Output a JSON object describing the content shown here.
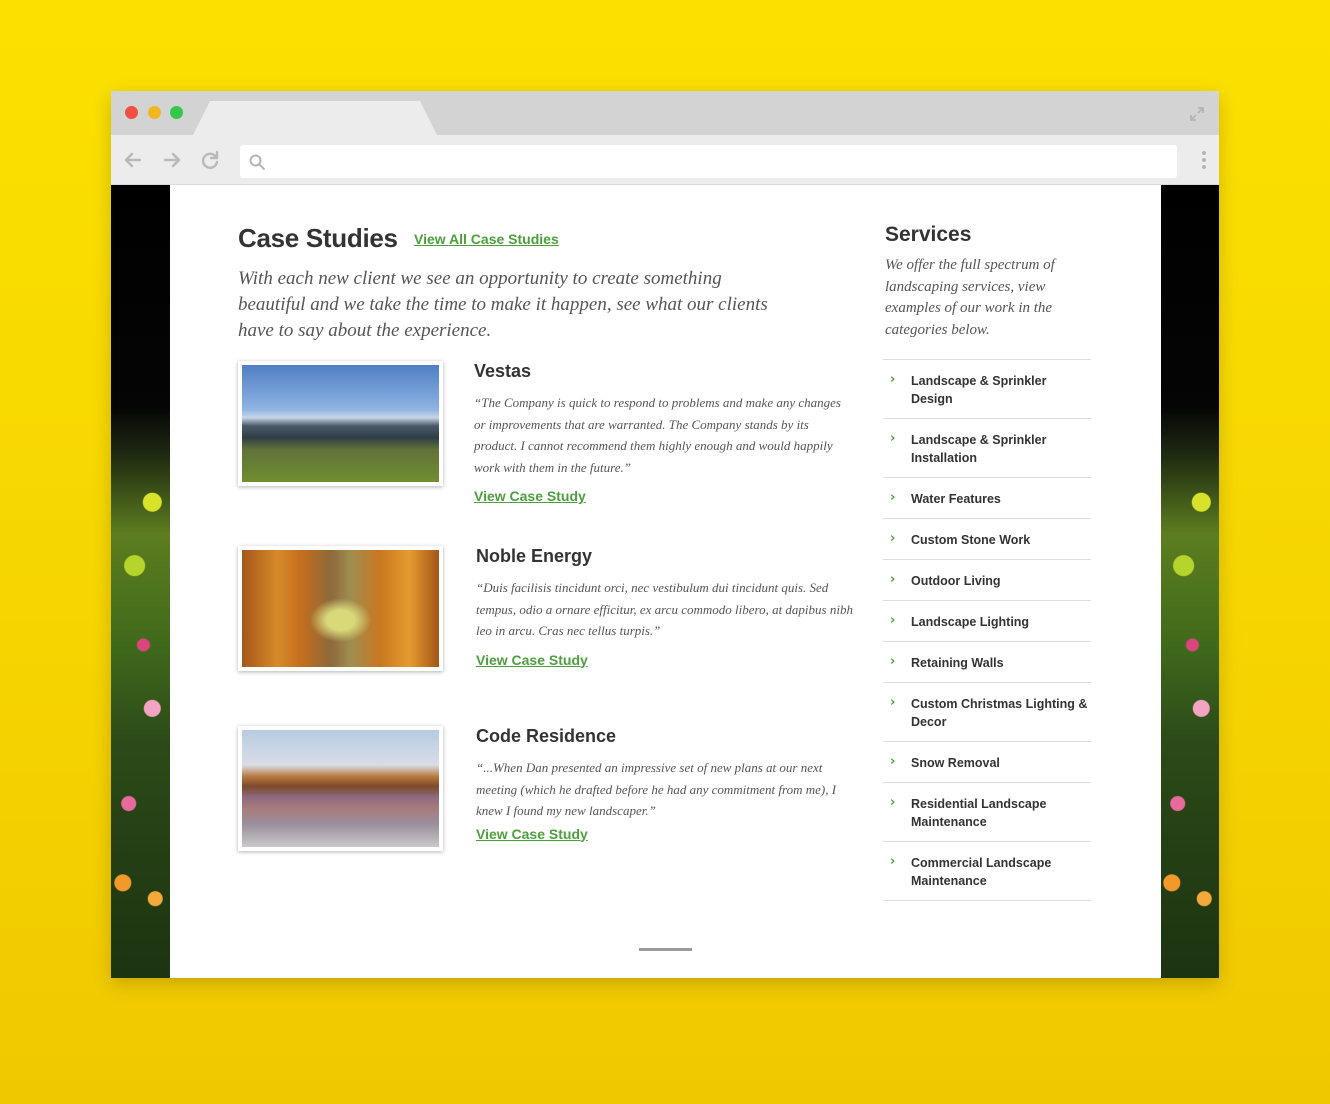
{
  "browser": {
    "url": "",
    "icons": {
      "back": "arrow-left-icon",
      "forward": "arrow-right-icon",
      "reload": "reload-icon",
      "search": "search-icon",
      "menu": "kebab-menu-icon",
      "expand": "expand-icon"
    }
  },
  "case_studies": {
    "title": "Case Studies",
    "view_all_label": "View All Case Studies",
    "intro": "With each new client we see an opportunity to create something beautiful and we take the time to make it happen, see what our clients have to say about the experience.",
    "items": [
      {
        "title": "Vestas",
        "quote": "“The Company is quick to respond to problems and make any changes or improvements that are warranted. The Company stands by its product. I cannot recommend them highly enough and would happily work with them in the future.”",
        "link_label": "View Case Study"
      },
      {
        "title": "Noble Energy",
        "quote": "“Duis facilisis tincidunt orci, nec vestibulum dui tincidunt quis. Sed tempus, odio a ornare efficitur, ex arcu commodo libero, at dapibus nibh leo in arcu. Cras nec tellus turpis.”",
        "link_label": "View Case Study"
      },
      {
        "title": "Code Residence",
        "quote": "“...When Dan presented an impressive set of new plans at our next meeting (which he drafted before he had any commitment from me), I knew I found my new landscaper.”",
        "link_label": "View Case Study"
      }
    ]
  },
  "services": {
    "title": "Services",
    "description": "We offer the full spectrum of landscaping services, view examples of our work in the categories below.",
    "items": [
      "Landscape & Sprinkler Design",
      "Landscape & Sprinkler Installation",
      "Water Features",
      "Custom Stone Work",
      "Outdoor Living",
      "Landscape Lighting",
      "Retaining Walls",
      "Custom Christmas Lighting & Decor",
      "Snow Removal",
      "Residential Landscape Maintenance",
      "Commercial Landscape Maintenance"
    ]
  },
  "colors": {
    "background": "#fbe100",
    "accent_green": "#4c9f3c",
    "heading": "#333333",
    "body_text": "#555555"
  }
}
